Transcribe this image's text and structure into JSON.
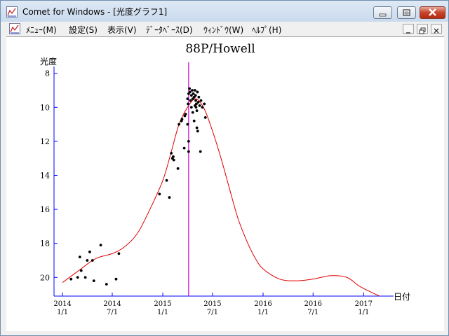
{
  "window": {
    "title": "Comet for Windows - [光度グラフ1]"
  },
  "menu": {
    "items": [
      {
        "label": "ﾒﾆｭｰ(M)"
      },
      {
        "label": "設定(S)"
      },
      {
        "label": "表示(V)"
      },
      {
        "label": "ﾃﾞｰﾀﾍﾞｰｽ(D)"
      },
      {
        "label": "ｳｨﾝﾄﾞｳ(W)"
      },
      {
        "label": "ﾍﾙﾌﾟ(H)"
      }
    ]
  },
  "chart_data": {
    "type": "scatter",
    "title": "88P/Howell",
    "ylabel": "光度",
    "xlabel": "日付",
    "y_inverted": true,
    "ylim": [
      21.1,
      7.6
    ],
    "xlim": [
      "2013-12-01",
      "2017-04-20"
    ],
    "y_ticks": [
      8,
      10,
      12,
      14,
      16,
      18,
      20
    ],
    "x_ticks": [
      {
        "date": "2014-01-01",
        "year": "2014",
        "md": "1/1"
      },
      {
        "date": "2014-07-01",
        "year": "2014",
        "md": "7/1"
      },
      {
        "date": "2015-01-01",
        "year": "2015",
        "md": "1/1"
      },
      {
        "date": "2015-07-01",
        "year": "2015",
        "md": "7/1"
      },
      {
        "date": "2016-01-01",
        "year": "2016",
        "md": "1/1"
      },
      {
        "date": "2016-07-01",
        "year": "2016",
        "md": "7/1"
      },
      {
        "date": "2017-01-01",
        "year": "2017",
        "md": "1/1"
      }
    ],
    "marker_line_date": "2015-04-05",
    "colors": {
      "axis": "#0000ff",
      "curve": "#e00000",
      "marker_line": "#cc00cc",
      "points": "#000000"
    },
    "predicted_curve": [
      [
        "2014-01-01",
        20.3
      ],
      [
        "2014-03-01",
        19.6
      ],
      [
        "2014-05-01",
        18.9
      ],
      [
        "2014-07-01",
        18.6
      ],
      [
        "2014-08-15",
        18.2
      ],
      [
        "2014-10-01",
        17.4
      ],
      [
        "2014-11-15",
        16.0
      ],
      [
        "2015-01-01",
        14.3
      ],
      [
        "2015-02-01",
        12.6
      ],
      [
        "2015-03-01",
        11.0
      ],
      [
        "2015-04-01",
        10.0
      ],
      [
        "2015-05-01",
        9.5
      ],
      [
        "2015-06-01",
        10.1
      ],
      [
        "2015-07-01",
        11.4
      ],
      [
        "2015-08-01",
        13.0
      ],
      [
        "2015-09-01",
        14.8
      ],
      [
        "2015-10-01",
        16.5
      ],
      [
        "2015-11-01",
        17.8
      ],
      [
        "2015-12-01",
        18.8
      ],
      [
        "2016-01-01",
        19.5
      ],
      [
        "2016-03-01",
        20.1
      ],
      [
        "2016-05-01",
        20.2
      ],
      [
        "2016-07-01",
        20.1
      ],
      [
        "2016-09-01",
        19.9
      ],
      [
        "2016-11-01",
        20.0
      ],
      [
        "2016-12-15",
        20.5
      ],
      [
        "2017-02-01",
        20.9
      ],
      [
        "2017-03-01",
        21.1
      ]
    ],
    "observations": [
      [
        "2014-02-01",
        20.1
      ],
      [
        "2014-02-25",
        20.0
      ],
      [
        "2014-03-10",
        19.6
      ],
      [
        "2014-03-25",
        20.0
      ],
      [
        "2014-03-05",
        18.8
      ],
      [
        "2014-04-01",
        19.0
      ],
      [
        "2014-04-10",
        18.5
      ],
      [
        "2014-04-20",
        19.0
      ],
      [
        "2014-04-25",
        20.2
      ],
      [
        "2014-05-20",
        18.1
      ],
      [
        "2014-06-10",
        20.4
      ],
      [
        "2014-07-15",
        20.1
      ],
      [
        "2014-07-25",
        18.6
      ],
      [
        "2014-12-20",
        15.1
      ],
      [
        "2015-01-15",
        14.3
      ],
      [
        "2015-01-25",
        15.3
      ],
      [
        "2015-02-01",
        12.7
      ],
      [
        "2015-02-05",
        13.0
      ],
      [
        "2015-02-08",
        12.9
      ],
      [
        "2015-02-10",
        13.1
      ],
      [
        "2015-02-25",
        13.6
      ],
      [
        "2015-03-01",
        11.0
      ],
      [
        "2015-03-10",
        10.8
      ],
      [
        "2015-03-12",
        10.7
      ],
      [
        "2015-03-20",
        12.4
      ],
      [
        "2015-03-22",
        10.5
      ],
      [
        "2015-03-25",
        10.4
      ],
      [
        "2015-04-01",
        11.0
      ],
      [
        "2015-04-05",
        12.6
      ],
      [
        "2015-04-05",
        12.0
      ],
      [
        "2015-04-01",
        9.5
      ],
      [
        "2015-04-03",
        9.8
      ],
      [
        "2015-04-05",
        9.2
      ],
      [
        "2015-04-08",
        8.9
      ],
      [
        "2015-04-10",
        9.1
      ],
      [
        "2015-04-12",
        9.6
      ],
      [
        "2015-04-15",
        10.0
      ],
      [
        "2015-04-15",
        9.3
      ],
      [
        "2015-04-18",
        9.0
      ],
      [
        "2015-04-20",
        9.5
      ],
      [
        "2015-04-20",
        10.3
      ],
      [
        "2015-04-22",
        9.2
      ],
      [
        "2015-04-25",
        9.4
      ],
      [
        "2015-04-25",
        10.8
      ],
      [
        "2015-04-28",
        9.0
      ],
      [
        "2015-04-30",
        9.3
      ],
      [
        "2015-05-01",
        9.6
      ],
      [
        "2015-05-03",
        9.8
      ],
      [
        "2015-05-05",
        10.2
      ],
      [
        "2015-05-05",
        11.2
      ],
      [
        "2015-05-08",
        11.4
      ],
      [
        "2015-05-10",
        9.7
      ],
      [
        "2015-05-12",
        9.4
      ],
      [
        "2015-05-15",
        9.9
      ],
      [
        "2015-05-18",
        12.6
      ],
      [
        "2015-05-20",
        9.6
      ],
      [
        "2015-05-25",
        10.0
      ],
      [
        "2015-06-01",
        9.8
      ],
      [
        "2015-06-05",
        10.6
      ],
      [
        "2015-04-28",
        9.9
      ],
      [
        "2015-05-02",
        10.0
      ],
      [
        "2015-05-07",
        9.1
      ]
    ]
  }
}
